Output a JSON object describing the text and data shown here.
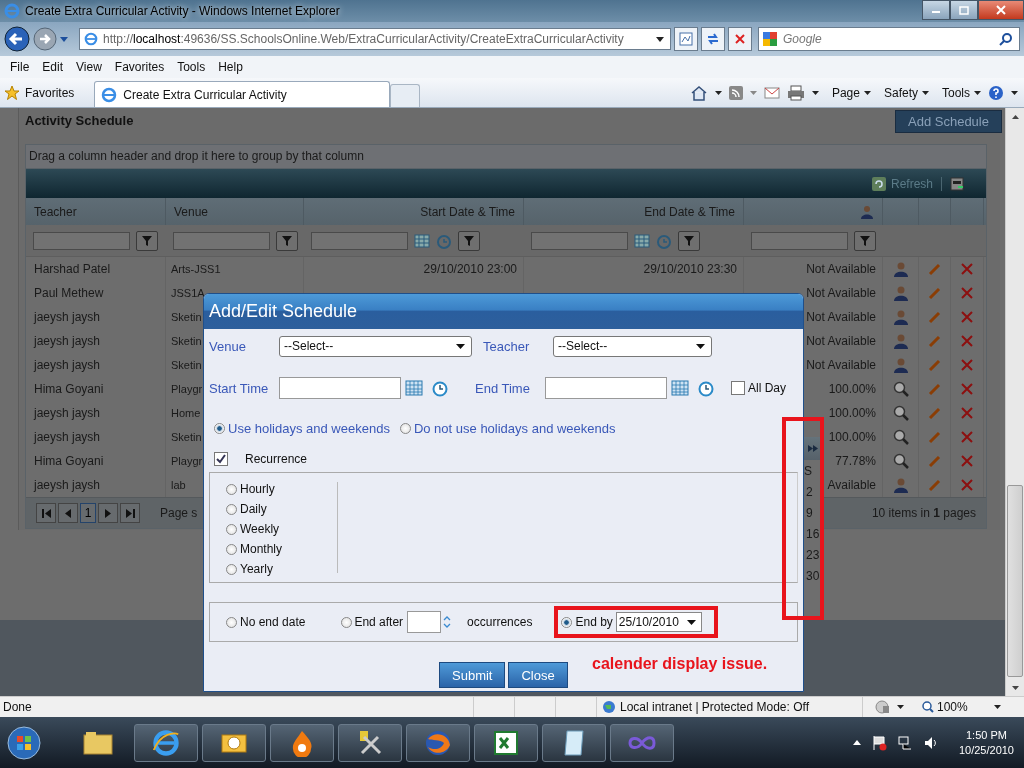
{
  "window": {
    "title": "Create Extra Curricular Activity - Windows Internet Explorer"
  },
  "address_bar": {
    "url_prefix": "http://",
    "url_host": "localhost",
    "url_rest": ":49636/SS.SchoolsOnline.Web/ExtraCurricularActivity/CreateExtraCurricularActivity",
    "search_placeholder": "Google"
  },
  "menu": [
    "File",
    "Edit",
    "View",
    "Favorites",
    "Tools",
    "Help"
  ],
  "favorites_bar": {
    "favorites": "Favorites",
    "tab": "Create Extra Curricular Activity",
    "commands": [
      "Page",
      "Safety",
      "Tools"
    ]
  },
  "page": {
    "title": "Activity Schedule",
    "add_button": "Add Schedule",
    "group_hint": "Drag a column header and drop it here to group by that column",
    "refresh": "Refresh",
    "columns": [
      "Teacher",
      "Venue",
      "Start Date & Time",
      "End Date & Time"
    ],
    "rows": [
      {
        "teacher": "Harshad Patel",
        "venue": "Arts-JSS1",
        "start": "29/10/2010 23:00",
        "end": "29/10/2010 23:30",
        "status": "Not Available",
        "kind": "person"
      },
      {
        "teacher": "Paul Methew",
        "venue": "JSS1A",
        "status": "Not Available",
        "kind": "person"
      },
      {
        "teacher": "jaeysh jaysh",
        "venue": "Sketin",
        "status": "Not Available",
        "kind": "person"
      },
      {
        "teacher": "jaeysh jaysh",
        "venue": "Sketin",
        "status": "Not Available",
        "kind": "person"
      },
      {
        "teacher": "jaeysh jaysh",
        "venue": "Sketin",
        "status": "Not Available",
        "kind": "person"
      },
      {
        "teacher": "Hima Goyani",
        "venue": "Playgr",
        "status": "100.00%",
        "kind": "magnifier"
      },
      {
        "teacher": "jaeysh jaysh",
        "venue": "Home",
        "status": "100.00%",
        "kind": "magnifier"
      },
      {
        "teacher": "jaeysh jaysh",
        "venue": "Sketin",
        "status": "100.00%",
        "kind": "magnifier"
      },
      {
        "teacher": "Hima Goyani",
        "venue": "Playgr",
        "status": "77.78%",
        "kind": "magnifier"
      },
      {
        "teacher": "jaeysh jaysh",
        "venue": "lab",
        "status": "Available",
        "kind": "person"
      }
    ],
    "pager": {
      "page": "1",
      "page_size_label": "Page s",
      "summary": "10 items in **1** pages"
    }
  },
  "dialog": {
    "title": "Add/Edit Schedule",
    "venue_label": "Venue",
    "venue_value": "--Select--",
    "teacher_label": "Teacher",
    "teacher_value": "--Select--",
    "start_label": "Start Time",
    "end_label": "End Time",
    "all_day": {
      "label": "All Day",
      "checked": false
    },
    "holiday_options": [
      {
        "label": "Use holidays and weekends",
        "selected": true
      },
      {
        "label": "Do not use holidays and weekends",
        "selected": false
      }
    ],
    "recurrence": {
      "label": "Recurrence",
      "checked": true
    },
    "frequencies": [
      {
        "label": "Hourly",
        "selected": false
      },
      {
        "label": "Daily",
        "selected": false
      },
      {
        "label": "Weekly",
        "selected": false
      },
      {
        "label": "Monthly",
        "selected": false
      },
      {
        "label": "Yearly",
        "selected": false
      }
    ],
    "end_options": [
      {
        "kind": "none",
        "label": "No end date",
        "selected": false
      },
      {
        "kind": "after",
        "label": "End after",
        "suffix": "occurrences",
        "selected": false
      },
      {
        "kind": "by",
        "label": "End by",
        "value": "25/10/2010",
        "selected": true
      }
    ],
    "buttons": [
      "Submit",
      "Close"
    ]
  },
  "calendar_fragment": {
    "day_header": "S",
    "days": [
      "2",
      "9",
      "16",
      "23",
      "30"
    ]
  },
  "annotation": {
    "text": "calender display issue."
  },
  "status_bar": {
    "text": "Done",
    "zone": "Local intranet | Protected Mode: Off",
    "zoom": "100%"
  },
  "taskbar": {
    "time": "1:50 PM",
    "date": "10/25/2010"
  }
}
